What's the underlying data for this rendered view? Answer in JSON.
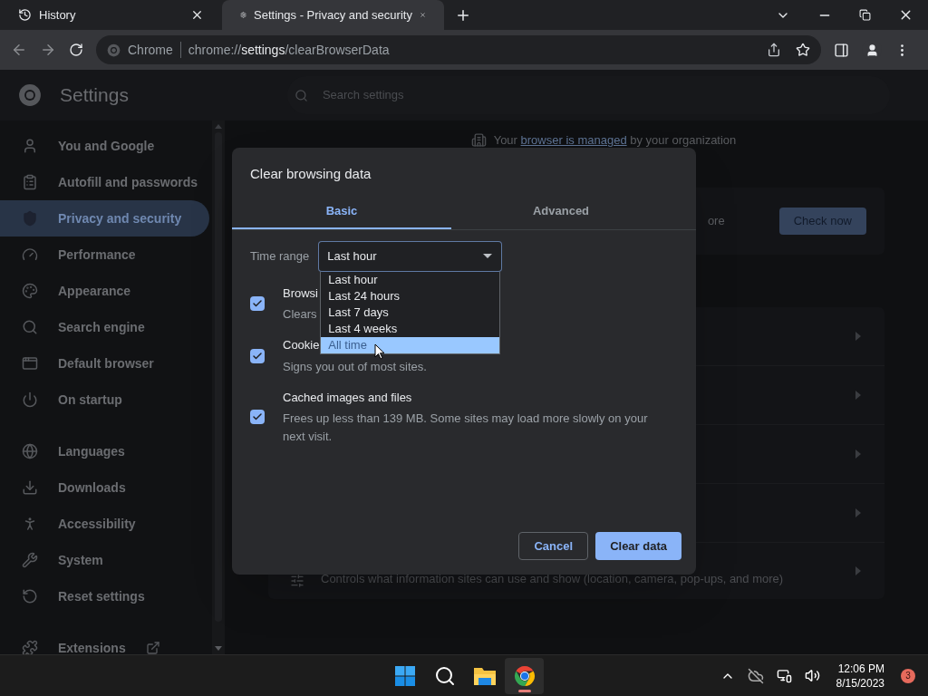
{
  "browser": {
    "tabs": [
      {
        "title": "History",
        "selected": false
      },
      {
        "title": "Settings - Privacy and security",
        "selected": true
      }
    ],
    "omnibox": {
      "site_label": "Chrome",
      "url": "chrome://**settings**/clearBrowserData"
    }
  },
  "settings": {
    "title": "Settings",
    "search_placeholder": "Search settings",
    "sidebar": {
      "groups": [
        {
          "items": [
            {
              "label": "You and Google",
              "selected": false,
              "kind": "page"
            },
            {
              "label": "Autofill and passwords",
              "selected": false,
              "kind": "page"
            },
            {
              "label": "Privacy and security",
              "selected": true,
              "kind": "page"
            },
            {
              "label": "Performance",
              "selected": false,
              "kind": "page"
            },
            {
              "label": "Appearance",
              "selected": false,
              "kind": "page"
            },
            {
              "label": "Search engine",
              "selected": false,
              "kind": "page"
            },
            {
              "label": "Default browser",
              "selected": false,
              "kind": "page"
            },
            {
              "label": "On startup",
              "selected": false,
              "kind": "page"
            }
          ]
        },
        {
          "items": [
            {
              "label": "Languages",
              "selected": false,
              "kind": "page"
            },
            {
              "label": "Downloads",
              "selected": false,
              "kind": "page"
            },
            {
              "label": "Accessibility",
              "selected": false,
              "kind": "page"
            },
            {
              "label": "System",
              "selected": false,
              "kind": "page"
            },
            {
              "label": "Reset settings",
              "selected": false,
              "kind": "page"
            }
          ]
        },
        {
          "items": [
            {
              "label": "Extensions",
              "selected": false,
              "kind": "external"
            }
          ]
        }
      ]
    },
    "main": {
      "managed_notice": {
        "before": "Your",
        "link": "browser is managed",
        "after": "by your organization"
      },
      "safety_check": {
        "text_fragment": "ore",
        "button": "Check now"
      },
      "site_settings": {
        "description": "Controls what information sites can use and show (location, camera, pop-ups, and more)"
      }
    }
  },
  "dialog": {
    "title": "Clear browsing data",
    "tabs": [
      {
        "label": "Basic",
        "selected": true
      },
      {
        "label": "Advanced",
        "selected": false
      }
    ],
    "time_range": {
      "label": "Time range",
      "value": "Last hour",
      "expanded": true,
      "options": [
        {
          "label": "Last hour",
          "highlighted": false
        },
        {
          "label": "Last 24 hours",
          "highlighted": false
        },
        {
          "label": "Last 7 days",
          "highlighted": false
        },
        {
          "label": "Last 4 weeks",
          "highlighted": false
        },
        {
          "label": "All time",
          "highlighted": true
        }
      ]
    },
    "items": [
      {
        "title": "Browsi",
        "description": "Clears",
        "checked": true
      },
      {
        "title": "Cookie",
        "description": "Signs you out of most sites.",
        "checked": true
      },
      {
        "title": "Cached images and files",
        "description": "Frees up less than 139 MB. Some sites may load more slowly on your next visit.",
        "checked": true
      }
    ],
    "buttons": {
      "cancel": "Cancel",
      "confirm": "Clear data"
    }
  },
  "taskbar": {
    "apps": [
      {
        "running": false
      },
      {
        "running": false
      },
      {
        "running": false
      },
      {
        "running": true
      }
    ],
    "time": "12:06 PM",
    "date": "8/15/2023",
    "notification_count": "3"
  }
}
